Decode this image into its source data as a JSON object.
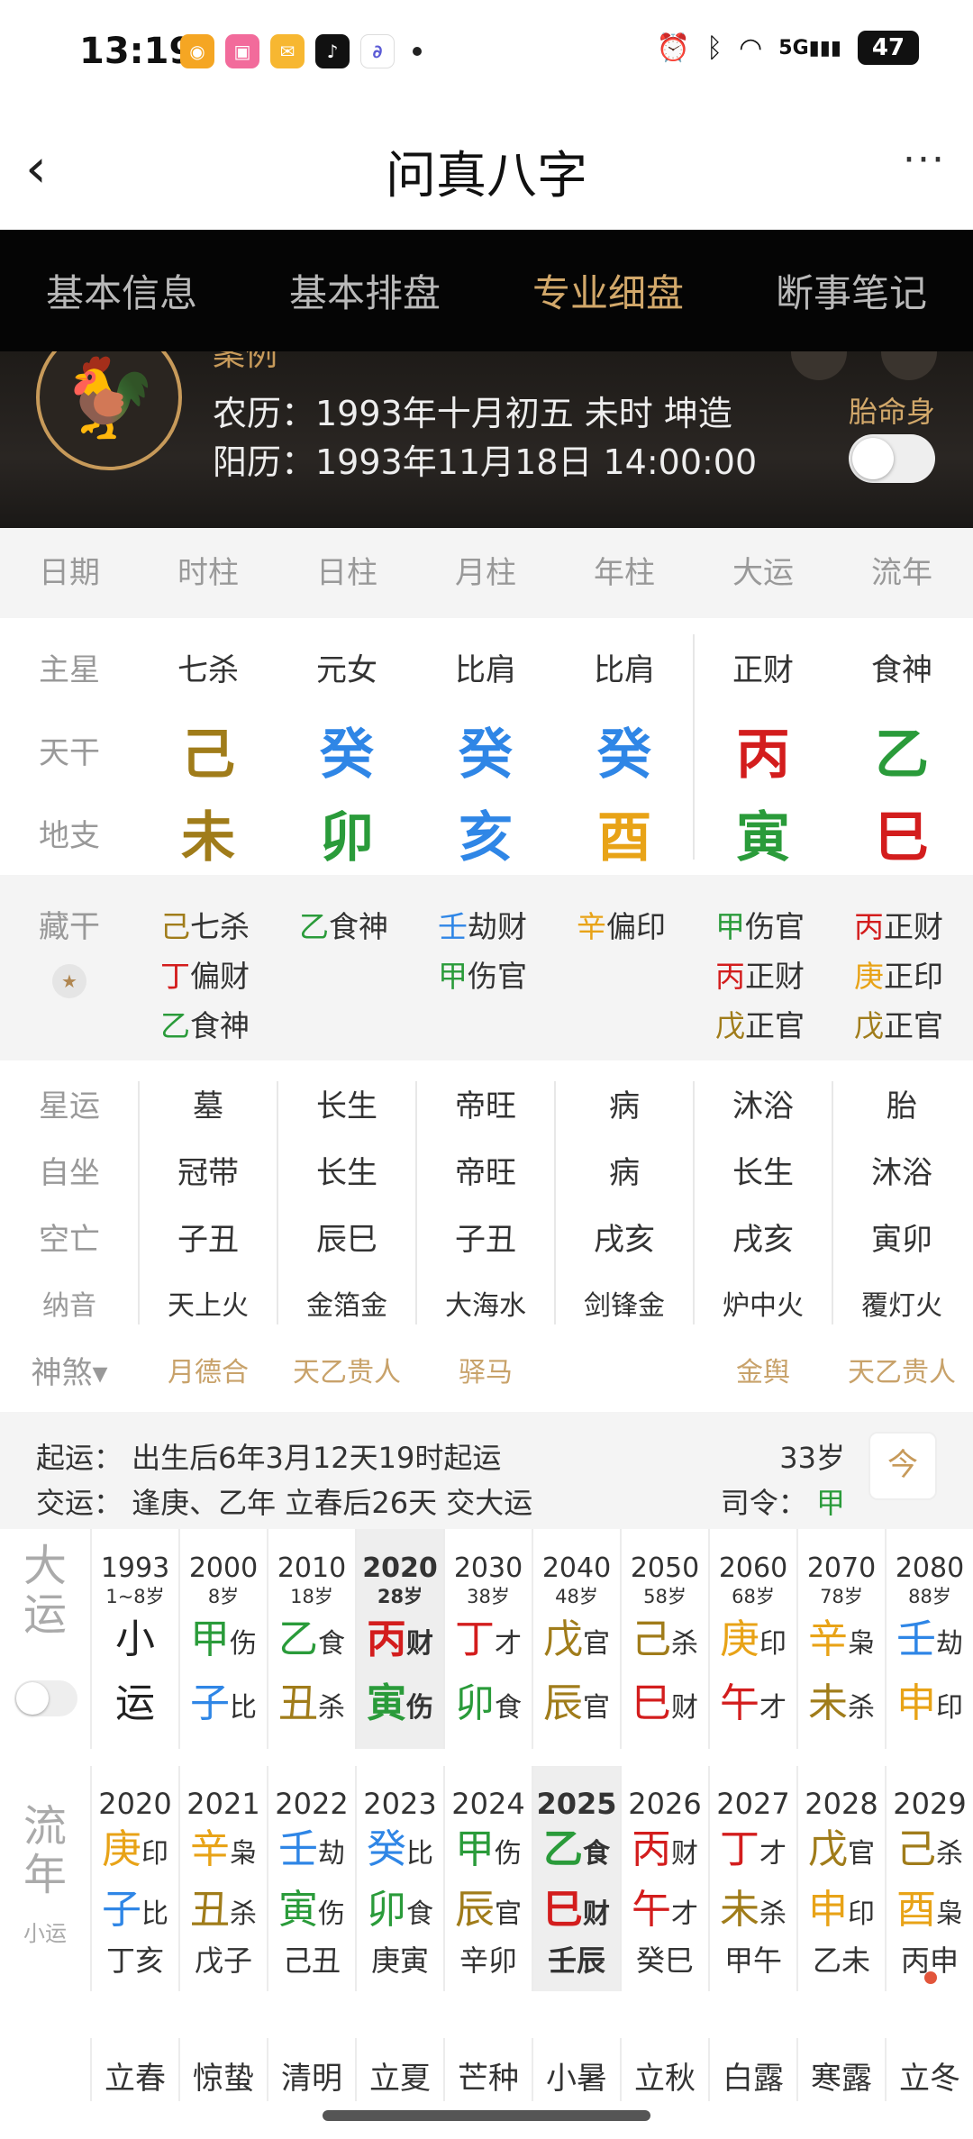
{
  "status": {
    "time": "13:19",
    "battery": "47",
    "network": "5G"
  },
  "header": {
    "title": "问真八字",
    "back": "‹",
    "more": "···"
  },
  "tabs": [
    "基本信息",
    "基本排盘",
    "专业细盘",
    "断事笔记"
  ],
  "profile": {
    "name": "案例",
    "lunar": "农历：1993年十月初五 未时 坤造",
    "solar": "阳历：1993年11月18日 14:00:00",
    "taimingshen": "胎命身"
  },
  "columns": [
    "日期",
    "时柱",
    "日柱",
    "月柱",
    "年柱",
    "大运",
    "流年"
  ],
  "labels": {
    "zhuxing": "主星",
    "tiangan": "天干",
    "dizhi": "地支",
    "canggan": "藏干",
    "xingyun": "星运",
    "zizuo": "自坐",
    "kongwang": "空亡",
    "nayin": "纳音",
    "shensha": "神煞▾"
  },
  "zhuxing": [
    "七杀",
    "元女",
    "比肩",
    "比肩",
    "正财",
    "食神"
  ],
  "tiangan": [
    {
      "char": "己",
      "color": "#a07c1a"
    },
    {
      "char": "癸",
      "color": "#2f86e6"
    },
    {
      "char": "癸",
      "color": "#2f86e6"
    },
    {
      "char": "癸",
      "color": "#2f86e6"
    },
    {
      "char": "丙",
      "color": "#d31d1d"
    },
    {
      "char": "乙",
      "color": "#2a9b3a"
    }
  ],
  "dizhi": [
    {
      "char": "未",
      "color": "#a07c1a"
    },
    {
      "char": "卯",
      "color": "#2a9b3a"
    },
    {
      "char": "亥",
      "color": "#2f86e6"
    },
    {
      "char": "酉",
      "color": "#e8a317"
    },
    {
      "char": "寅",
      "color": "#2a9b3a"
    },
    {
      "char": "巳",
      "color": "#d31d1d"
    }
  ],
  "canggan": [
    [
      {
        "g": "己",
        "c": "#a07c1a",
        "s": "七杀"
      },
      {
        "g": "丁",
        "c": "#d31d1d",
        "s": "偏财"
      },
      {
        "g": "乙",
        "c": "#2a9b3a",
        "s": "食神"
      }
    ],
    [
      {
        "g": "乙",
        "c": "#2a9b3a",
        "s": "食神"
      }
    ],
    [
      {
        "g": "壬",
        "c": "#2f86e6",
        "s": "劫财"
      },
      {
        "g": "甲",
        "c": "#2a9b3a",
        "s": "伤官"
      }
    ],
    [
      {
        "g": "辛",
        "c": "#e8a317",
        "s": "偏印"
      }
    ],
    [
      {
        "g": "甲",
        "c": "#2a9b3a",
        "s": "伤官"
      },
      {
        "g": "丙",
        "c": "#d31d1d",
        "s": "正财"
      },
      {
        "g": "戊",
        "c": "#a07c1a",
        "s": "正官"
      }
    ],
    [
      {
        "g": "丙",
        "c": "#d31d1d",
        "s": "正财"
      },
      {
        "g": "庚",
        "c": "#e8a317",
        "s": "正印"
      },
      {
        "g": "戊",
        "c": "#a07c1a",
        "s": "正官"
      }
    ]
  ],
  "xingyun": [
    "墓",
    "长生",
    "帝旺",
    "病",
    "沐浴",
    "胎"
  ],
  "zizuo": [
    "冠带",
    "长生",
    "帝旺",
    "病",
    "长生",
    "沐浴"
  ],
  "kongwang": [
    "子丑",
    "辰巳",
    "子丑",
    "戌亥",
    "戌亥",
    "寅卯"
  ],
  "nayin": [
    "天上火",
    "金箔金",
    "大海水",
    "剑锋金",
    "炉中火",
    "覆灯火"
  ],
  "shensha": [
    "月德合",
    "天乙贵人",
    "驿马",
    "",
    "金舆",
    "天乙贵人"
  ],
  "qiyun": {
    "line1": "起运：  出生后6年3月12天19时起运",
    "line2": "交运：  逢庚、乙年 立春后26天 交大运",
    "age": "33岁",
    "siling_label": "司令：",
    "siling_value": "甲",
    "cal_icon": "今"
  },
  "dayun": {
    "side1": "大",
    "side2": "运",
    "cols": [
      {
        "year": "1993",
        "age": "1~8岁",
        "g": "小",
        "gc": "#222",
        "gs": "",
        "z": "运",
        "zc": "#222",
        "zs": ""
      },
      {
        "year": "2000",
        "age": "8岁",
        "g": "甲",
        "gc": "#2a9b3a",
        "gs": "伤",
        "z": "子",
        "zc": "#2f86e6",
        "zs": "比"
      },
      {
        "year": "2010",
        "age": "18岁",
        "g": "乙",
        "gc": "#2a9b3a",
        "gs": "食",
        "z": "丑",
        "zc": "#a07c1a",
        "zs": "杀"
      },
      {
        "year": "2020",
        "age": "28岁",
        "g": "丙",
        "gc": "#d31d1d",
        "gs": "财",
        "z": "寅",
        "zc": "#2a9b3a",
        "zs": "伤",
        "sel": true
      },
      {
        "year": "2030",
        "age": "38岁",
        "g": "丁",
        "gc": "#d31d1d",
        "gs": "才",
        "z": "卯",
        "zc": "#2a9b3a",
        "zs": "食"
      },
      {
        "year": "2040",
        "age": "48岁",
        "g": "戊",
        "gc": "#a07c1a",
        "gs": "官",
        "z": "辰",
        "zc": "#a07c1a",
        "zs": "官"
      },
      {
        "year": "2050",
        "age": "58岁",
        "g": "己",
        "gc": "#a07c1a",
        "gs": "杀",
        "z": "巳",
        "zc": "#d31d1d",
        "zs": "财"
      },
      {
        "year": "2060",
        "age": "68岁",
        "g": "庚",
        "gc": "#e8a317",
        "gs": "印",
        "z": "午",
        "zc": "#d31d1d",
        "zs": "才"
      },
      {
        "year": "2070",
        "age": "78岁",
        "g": "辛",
        "gc": "#e8a317",
        "gs": "枭",
        "z": "未",
        "zc": "#a07c1a",
        "zs": "杀"
      },
      {
        "year": "2080",
        "age": "88岁",
        "g": "壬",
        "gc": "#2f86e6",
        "gs": "劫",
        "z": "申",
        "zc": "#e8a317",
        "zs": "印"
      }
    ]
  },
  "liunian": {
    "side1": "流",
    "side2": "年",
    "side3": "小运",
    "cols": [
      {
        "year": "2020",
        "g": "庚",
        "gc": "#e8a317",
        "gs": "印",
        "z": "子",
        "zc": "#2f86e6",
        "zs": "比",
        "xy": "丁亥"
      },
      {
        "year": "2021",
        "g": "辛",
        "gc": "#e8a317",
        "gs": "枭",
        "z": "丑",
        "zc": "#a07c1a",
        "zs": "杀",
        "xy": "戊子"
      },
      {
        "year": "2022",
        "g": "壬",
        "gc": "#2f86e6",
        "gs": "劫",
        "z": "寅",
        "zc": "#2a9b3a",
        "zs": "伤",
        "xy": "己丑"
      },
      {
        "year": "2023",
        "g": "癸",
        "gc": "#2f86e6",
        "gs": "比",
        "z": "卯",
        "zc": "#2a9b3a",
        "zs": "食",
        "xy": "庚寅"
      },
      {
        "year": "2024",
        "g": "甲",
        "gc": "#2a9b3a",
        "gs": "伤",
        "z": "辰",
        "zc": "#a07c1a",
        "zs": "官",
        "xy": "辛卯"
      },
      {
        "year": "2025",
        "g": "乙",
        "gc": "#2a9b3a",
        "gs": "食",
        "z": "巳",
        "zc": "#d31d1d",
        "zs": "财",
        "xy": "壬辰",
        "sel": true
      },
      {
        "year": "2026",
        "g": "丙",
        "gc": "#d31d1d",
        "gs": "财",
        "z": "午",
        "zc": "#d31d1d",
        "zs": "才",
        "xy": "癸巳"
      },
      {
        "year": "2027",
        "g": "丁",
        "gc": "#d31d1d",
        "gs": "才",
        "z": "未",
        "zc": "#a07c1a",
        "zs": "杀",
        "xy": "甲午"
      },
      {
        "year": "2028",
        "g": "戊",
        "gc": "#a07c1a",
        "gs": "官",
        "z": "申",
        "zc": "#e8a317",
        "zs": "印",
        "xy": "乙未"
      },
      {
        "year": "2029",
        "g": "己",
        "gc": "#a07c1a",
        "gs": "杀",
        "z": "酉",
        "zc": "#e8a317",
        "zs": "枭",
        "xy": "丙申"
      }
    ]
  },
  "jieqi": [
    "立春",
    "惊蛰",
    "清明",
    "立夏",
    "芒种",
    "小暑",
    "立秋",
    "白露",
    "寒露",
    "立冬"
  ]
}
